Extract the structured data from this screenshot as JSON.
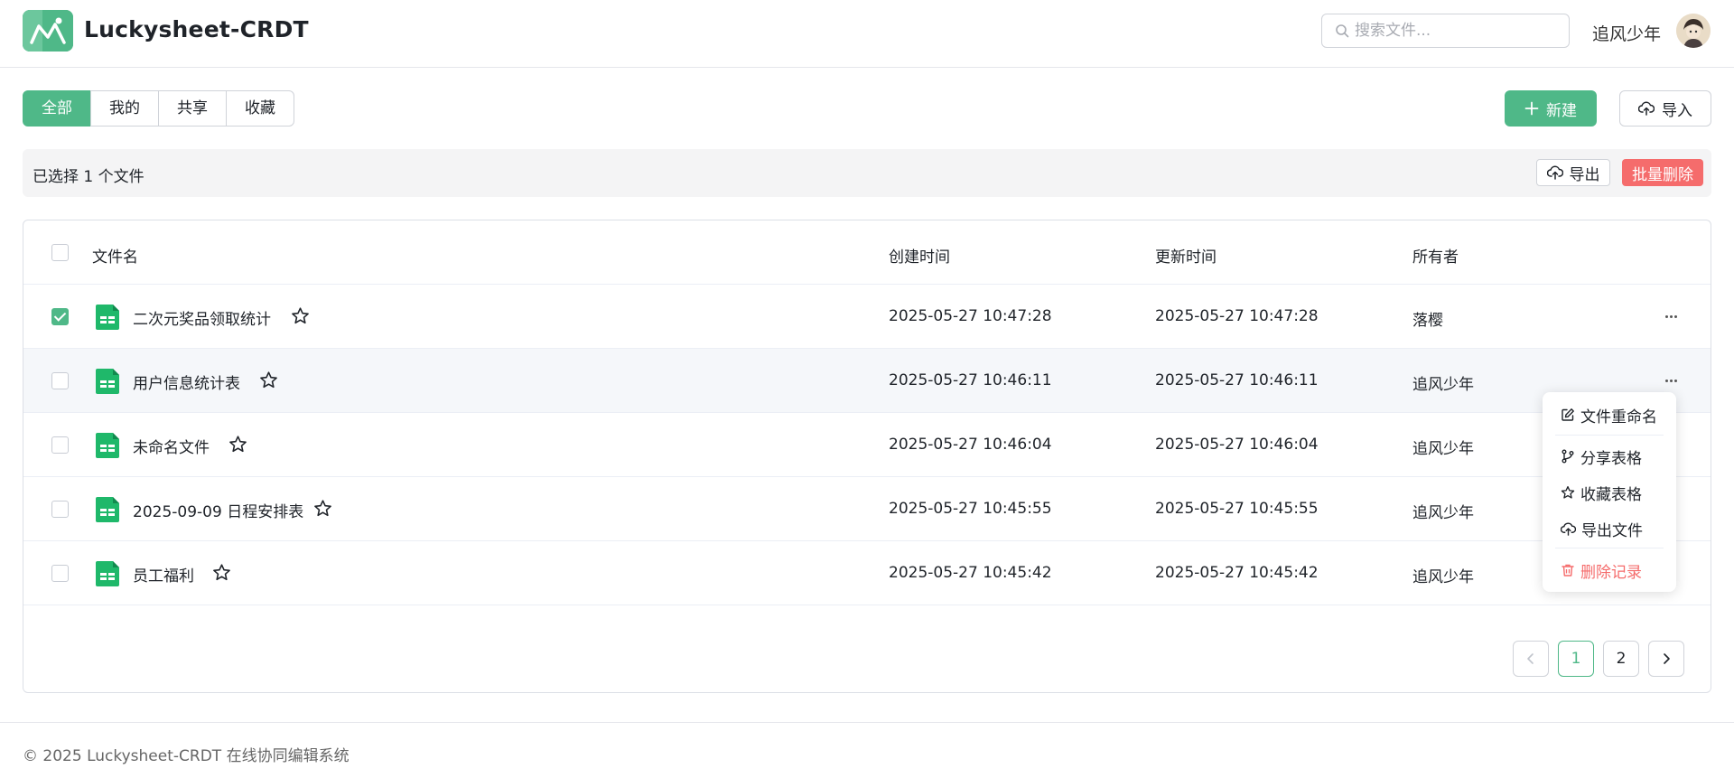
{
  "header": {
    "app_title": "Luckysheet-CRDT",
    "search_placeholder": "搜索文件...",
    "user_name": "追风少年"
  },
  "tabs": [
    {
      "label": "全部",
      "active": true
    },
    {
      "label": "我的",
      "active": false
    },
    {
      "label": "共享",
      "active": false
    },
    {
      "label": "收藏",
      "active": false
    }
  ],
  "actions": {
    "new_label": "新建",
    "import_label": "导入"
  },
  "selection": {
    "text": "已选择 1 个文件",
    "export_label": "导出",
    "batch_delete_label": "批量删除"
  },
  "table": {
    "columns": [
      "文件名",
      "创建时间",
      "更新时间",
      "所有者"
    ],
    "rows": [
      {
        "name": "二次元奖品领取统计",
        "created": "2025-05-27 10:47:28",
        "updated": "2025-05-27 10:47:28",
        "owner": "落樱",
        "checked": true
      },
      {
        "name": "用户信息统计表",
        "created": "2025-05-27 10:46:11",
        "updated": "2025-05-27 10:46:11",
        "owner": "追风少年",
        "checked": false
      },
      {
        "name": "未命名文件",
        "created": "2025-05-27 10:46:04",
        "updated": "2025-05-27 10:46:04",
        "owner": "追风少年",
        "checked": false
      },
      {
        "name": "2025-09-09 日程安排表",
        "created": "2025-05-27 10:45:55",
        "updated": "2025-05-27 10:45:55",
        "owner": "追风少年",
        "checked": false
      },
      {
        "name": "员工福利",
        "created": "2025-05-27 10:45:42",
        "updated": "2025-05-27 10:45:42",
        "owner": "追风少年",
        "checked": false
      }
    ]
  },
  "pagination": {
    "pages": [
      "1",
      "2"
    ],
    "current": "1"
  },
  "context_menu": {
    "items": [
      {
        "label": "文件重命名",
        "icon": "edit-icon"
      },
      {
        "label": "分享表格",
        "icon": "share-branch-icon"
      },
      {
        "label": "收藏表格",
        "icon": "star-icon"
      },
      {
        "label": "导出文件",
        "icon": "cloud-upload-icon"
      },
      {
        "label": "删除记录",
        "icon": "trash-icon"
      }
    ]
  },
  "footer": {
    "text": "© 2025 Luckysheet-CRDT 在线协同编辑系统"
  },
  "colors": {
    "primary": "#4fb888",
    "danger": "#f56c6c",
    "file_icon": "#1fb86a"
  }
}
